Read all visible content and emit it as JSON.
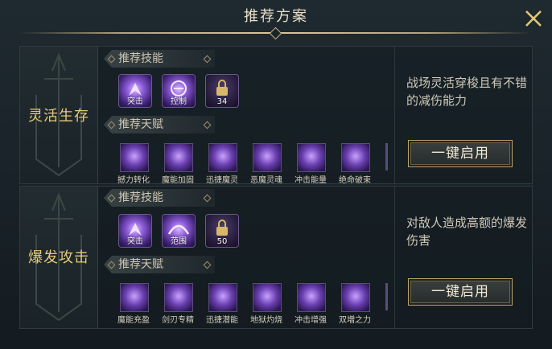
{
  "header": {
    "title": "推荐方案",
    "close_icon": "close-icon"
  },
  "plans": [
    {
      "name": "灵活生存",
      "skills_label": "推荐技能",
      "talents_label": "推荐天赋",
      "skills": [
        {
          "tag": "突击",
          "icon": "dash-icon"
        },
        {
          "tag": "控制",
          "icon": "control-icon"
        },
        {
          "tag": "34",
          "icon": "lock-icon"
        }
      ],
      "talents": [
        "撼力转化",
        "魔能加固",
        "迅捷魔灵",
        "恶魔灵魂",
        "冲击能量",
        "绝命破束"
      ],
      "description": "战场灵活穿梭且有不错的减伤能力",
      "apply_label": "一键启用"
    },
    {
      "name": "爆发攻击",
      "skills_label": "推荐技能",
      "talents_label": "推荐天赋",
      "skills": [
        {
          "tag": "突击",
          "icon": "dash-icon"
        },
        {
          "tag": "范围",
          "icon": "area-icon"
        },
        {
          "tag": "50",
          "icon": "lock-icon"
        }
      ],
      "talents": [
        "魔能充盈",
        "剑刃专精",
        "迅捷潜能",
        "地狱灼烧",
        "冲击增强",
        "双増之力"
      ],
      "description": "对敌人造成高额的爆发伤害",
      "apply_label": "一键启用"
    }
  ],
  "colors": {
    "accent_gold": "#e6c978",
    "skill_purple": "#8b5ad6"
  }
}
